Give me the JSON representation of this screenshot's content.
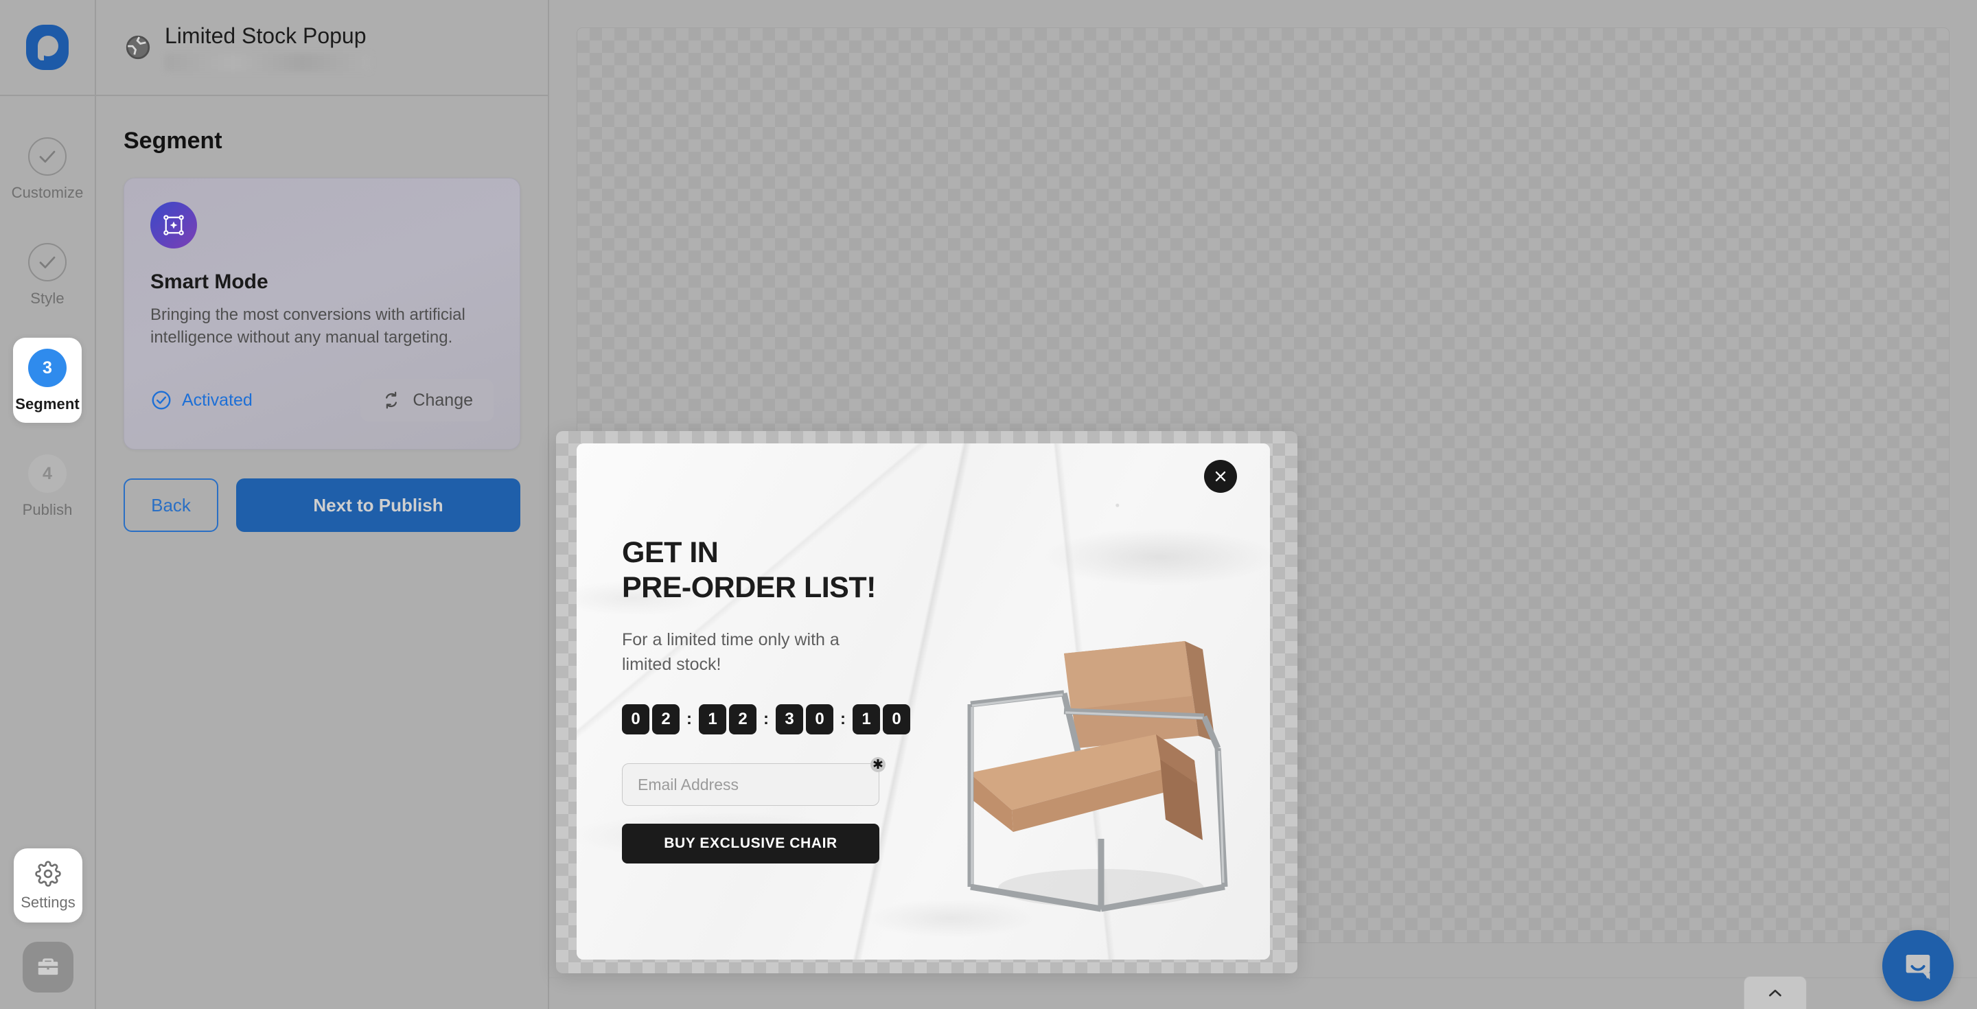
{
  "brand": {
    "logo_name": "popupsmart-logo",
    "accent": "#1f5faa"
  },
  "rail": {
    "steps": [
      {
        "label": "Customize",
        "badge": "check",
        "state": "done"
      },
      {
        "label": "Style",
        "badge": "check",
        "state": "done"
      },
      {
        "label": "Segment",
        "badge": "3",
        "state": "active"
      },
      {
        "label": "Publish",
        "badge": "4",
        "state": "todo"
      }
    ],
    "settings_label": "Settings"
  },
  "header": {
    "title": "Limited Stock Popup",
    "url_blurred": true
  },
  "panel": {
    "section_title": "Segment",
    "smart_card": {
      "name": "Smart Mode",
      "description": "Bringing the most conversions with artificial intelligence without any manual targeting.",
      "status_label": "Activated",
      "change_label": "Change"
    },
    "back_label": "Back",
    "next_label": "Next to Publish"
  },
  "popup_preview": {
    "headline_line1": "GET IN",
    "headline_line2": "PRE-ORDER LIST!",
    "subtext": "For a limited time only with a limited stock!",
    "countdown": {
      "groups": [
        [
          "0",
          "2"
        ],
        [
          "1",
          "2"
        ],
        [
          "3",
          "0"
        ],
        [
          "1",
          "0"
        ]
      ],
      "separator": ":"
    },
    "email_placeholder": "Email Address",
    "email_value": "",
    "required_marker": "✱",
    "cta_label": "BUY EXCLUSIVE CHAIR",
    "close_label": "×",
    "image_alt": "tan-leather-lounge-chair"
  }
}
